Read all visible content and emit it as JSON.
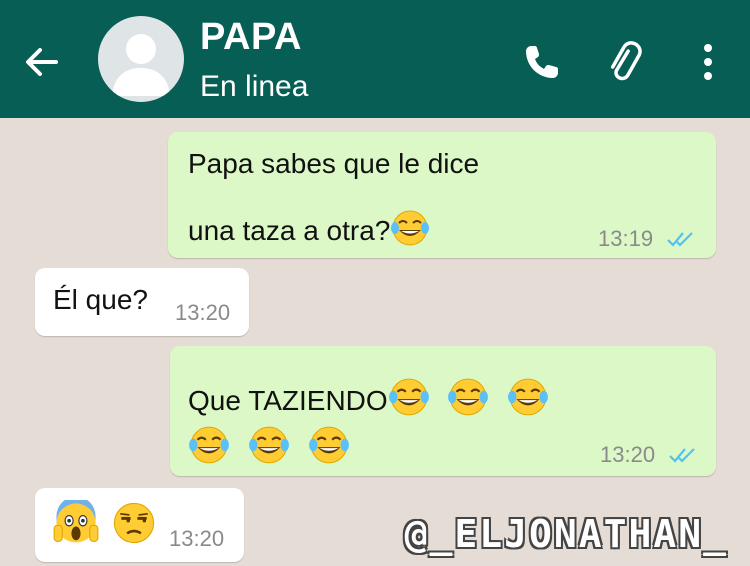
{
  "header": {
    "contact_name": "PAPA",
    "status": "En linea",
    "background_color": "#075e54",
    "icons": [
      "back-arrow-icon",
      "avatar-placeholder-icon",
      "phone-icon",
      "paperclip-icon",
      "more-vert-icon"
    ]
  },
  "chat": {
    "messages": [
      {
        "direction": "outgoing",
        "lines": [
          "Papa sabes que le dice",
          "una taza a otra?"
        ],
        "emoji": [
          "face-with-tears-of-joy"
        ],
        "time": "13:19",
        "status": "read"
      },
      {
        "direction": "incoming",
        "lines": [
          "Él que?"
        ],
        "time": "13:20"
      },
      {
        "direction": "outgoing",
        "lines": [
          "Que TAZIENDO"
        ],
        "emoji": [
          "face-with-tears-of-joy",
          "face-with-tears-of-joy",
          "face-with-tears-of-joy",
          "face-with-tears-of-joy",
          "face-with-tears-of-joy",
          "face-with-tears-of-joy"
        ],
        "time": "13:20",
        "status": "read"
      },
      {
        "direction": "incoming",
        "lines": [
          ""
        ],
        "emoji": [
          "face-screaming-in-fear",
          "unamused-face"
        ],
        "time": "13:20"
      }
    ],
    "outgoing_color": "#dcf8c6",
    "incoming_color": "#ffffff",
    "read_tick_color": "#4fc3f7"
  },
  "watermark": "@_ELJONATHAN_"
}
